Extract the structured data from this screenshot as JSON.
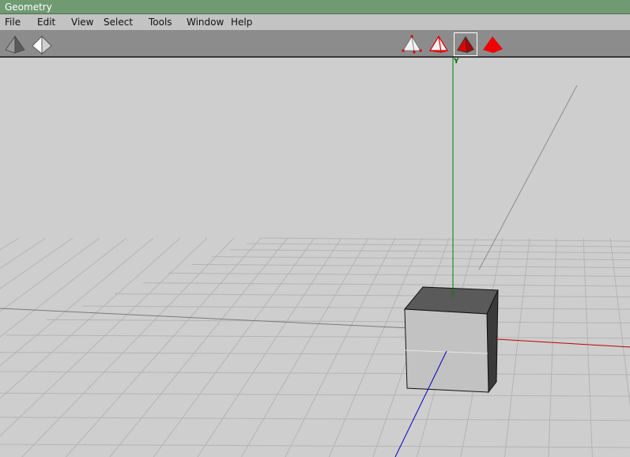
{
  "window": {
    "title": "Geometry"
  },
  "menu": {
    "file": "File",
    "edit": "Edit",
    "view": "View",
    "select": "Select",
    "tools": "Tools",
    "window": "Window",
    "help": "Help"
  },
  "toolbar": {
    "left_tools": [
      {
        "icon": "shaded-pyramid-icon"
      },
      {
        "icon": "light-pyramid-icon"
      }
    ],
    "render_modes": [
      {
        "icon": "vertex-pyramid-icon",
        "selected": false
      },
      {
        "icon": "wireframe-pyramid-icon",
        "selected": false
      },
      {
        "icon": "edge-shaded-pyramid-icon",
        "selected": true
      },
      {
        "icon": "solid-pyramid-icon",
        "selected": false
      }
    ]
  },
  "viewport": {
    "y_axis_label": "Y",
    "colors": {
      "x_axis": "#c00000",
      "y_axis": "#008000",
      "z_axis": "#0000c0",
      "grid": "#b4b4b4",
      "background": "#cecece"
    }
  }
}
